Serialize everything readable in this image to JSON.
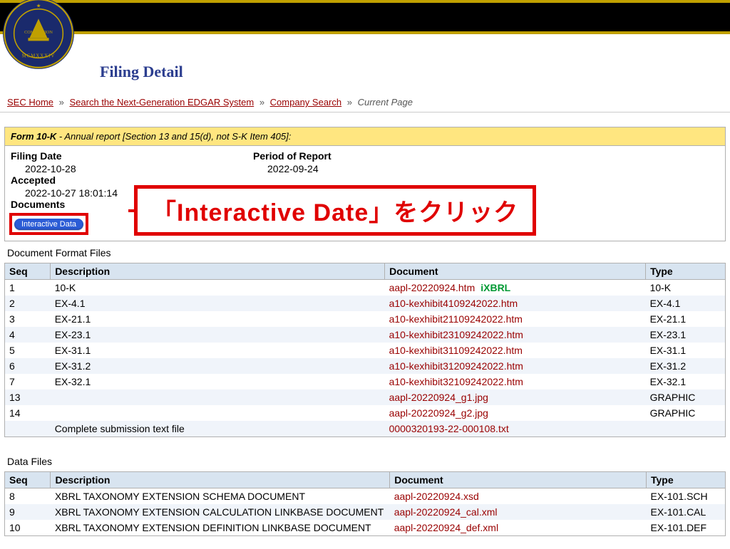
{
  "page_title": "Filing Detail",
  "breadcrumb": {
    "home": "SEC Home",
    "search": "Search the Next-Generation EDGAR System",
    "company": "Company Search",
    "current": "Current Page",
    "sep": "»"
  },
  "form_header": {
    "form": "Form 10-K",
    "desc": " - Annual report [Section 13 and 15(d), not S-K Item 405]:"
  },
  "meta": {
    "filing_date_label": "Filing Date",
    "filing_date": "2022-10-28",
    "accepted_label": "Accepted",
    "accepted": "2022-10-27 18:01:14",
    "documents_label": "Documents",
    "period_label": "Period of Report",
    "period": "2022-09-24"
  },
  "interactive_button": "Interactive Data",
  "callout_text": "「Interactive Date」をクリック",
  "doc_section_title": "Document Format Files",
  "data_section_title": "Data Files",
  "columns": {
    "seq": "Seq",
    "desc": "Description",
    "doc": "Document",
    "type": "Type"
  },
  "ixbrl_tag": "iXBRL",
  "doc_rows": [
    {
      "seq": "1",
      "desc": "10-K",
      "doc": "aapl-20220924.htm",
      "ixbrl": true,
      "type": "10-K"
    },
    {
      "seq": "2",
      "desc": "EX-4.1",
      "doc": "a10-kexhibit4109242022.htm",
      "type": "EX-4.1"
    },
    {
      "seq": "3",
      "desc": "EX-21.1",
      "doc": "a10-kexhibit21109242022.htm",
      "type": "EX-21.1"
    },
    {
      "seq": "4",
      "desc": "EX-23.1",
      "doc": "a10-kexhibit23109242022.htm",
      "type": "EX-23.1"
    },
    {
      "seq": "5",
      "desc": "EX-31.1",
      "doc": "a10-kexhibit31109242022.htm",
      "type": "EX-31.1"
    },
    {
      "seq": "6",
      "desc": "EX-31.2",
      "doc": "a10-kexhibit31209242022.htm",
      "type": "EX-31.2"
    },
    {
      "seq": "7",
      "desc": "EX-32.1",
      "doc": "a10-kexhibit32109242022.htm",
      "type": "EX-32.1"
    },
    {
      "seq": "13",
      "desc": "",
      "doc": "aapl-20220924_g1.jpg",
      "type": "GRAPHIC"
    },
    {
      "seq": "14",
      "desc": "",
      "doc": "aapl-20220924_g2.jpg",
      "type": "GRAPHIC"
    },
    {
      "seq": "",
      "desc": "Complete submission text file",
      "doc": "0000320193-22-000108.txt",
      "type": ""
    }
  ],
  "data_rows": [
    {
      "seq": "8",
      "desc": "XBRL TAXONOMY EXTENSION SCHEMA DOCUMENT",
      "doc": "aapl-20220924.xsd",
      "type": "EX-101.SCH"
    },
    {
      "seq": "9",
      "desc": "XBRL TAXONOMY EXTENSION CALCULATION LINKBASE DOCUMENT",
      "doc": "aapl-20220924_cal.xml",
      "type": "EX-101.CAL"
    },
    {
      "seq": "10",
      "desc": "XBRL TAXONOMY EXTENSION DEFINITION LINKBASE DOCUMENT",
      "doc": "aapl-20220924_def.xml",
      "type": "EX-101.DEF"
    }
  ]
}
